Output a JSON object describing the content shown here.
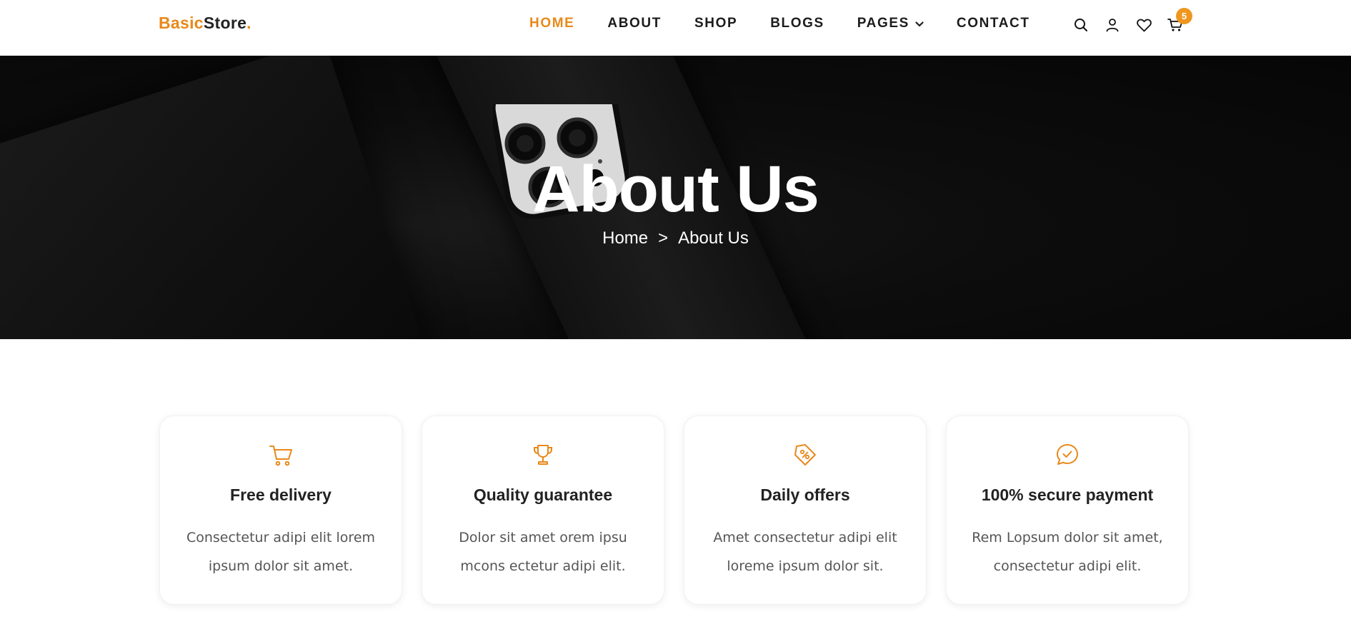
{
  "brand": {
    "part1": "Basic",
    "part2": "Store",
    "part3": "."
  },
  "nav": [
    {
      "label": "HOME",
      "active": true
    },
    {
      "label": "ABOUT",
      "active": false
    },
    {
      "label": "SHOP",
      "active": false
    },
    {
      "label": "BLOGS",
      "active": false
    },
    {
      "label": "PAGES",
      "active": false,
      "dropdown": true
    },
    {
      "label": "CONTACT",
      "active": false
    }
  ],
  "header_icons": [
    "search-icon",
    "user-icon",
    "heart-icon",
    "cart-icon"
  ],
  "cart_count": "5",
  "hero": {
    "title": "About Us",
    "breadcrumb": {
      "home": "Home",
      "separator": ">",
      "current": "About Us"
    }
  },
  "features": [
    {
      "icon": "cart-icon",
      "title": "Free delivery",
      "text_line1": "Consectetur adipi elit lorem",
      "text_line2": "ipsum dolor sit amet."
    },
    {
      "icon": "trophy-icon",
      "title": "Quality guarantee",
      "text_line1": "Dolor sit amet orem ipsu",
      "text_line2": "mcons ectetur adipi elit."
    },
    {
      "icon": "tag-icon",
      "title": "Daily offers",
      "text_line1": "Amet consectetur adipi elit",
      "text_line2": "loreme ipsum dolor sit."
    },
    {
      "icon": "chat-check-icon",
      "title": "100% secure payment",
      "text_line1": "Rem Lopsum dolor sit amet,",
      "text_line2": "consectetur adipi elit."
    }
  ],
  "colors": {
    "accent": "#e8891a",
    "text": "#222222",
    "hero_bg": "#0b0b0b"
  }
}
